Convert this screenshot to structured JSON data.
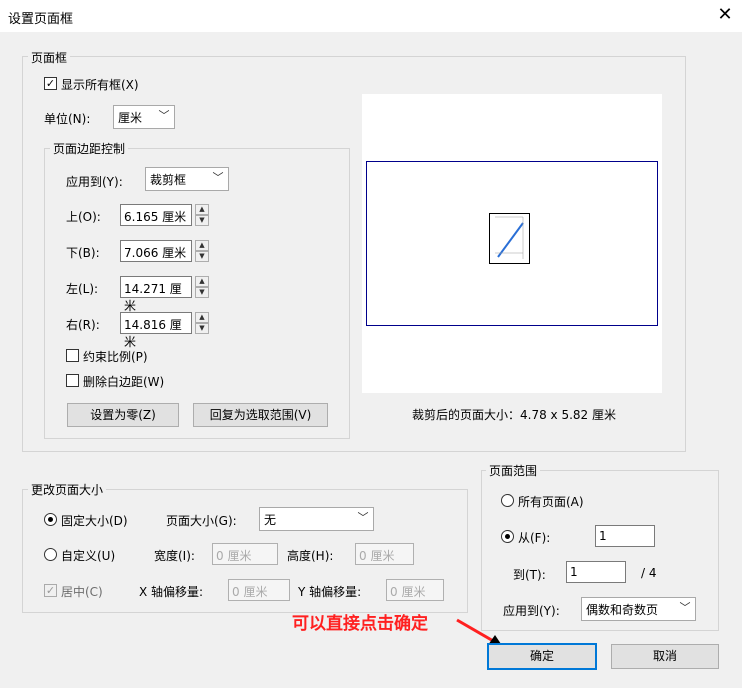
{
  "window": {
    "title": "设置页面框",
    "close_glyph": "✕"
  },
  "page_box": {
    "legend": "页面框",
    "show_all_boxes": {
      "label": "显示所有框(X)",
      "checked": true
    },
    "unit": {
      "label": "单位(N):",
      "value": "厘米"
    }
  },
  "margin_control": {
    "legend": "页面边距控制",
    "apply_to": {
      "label": "应用到(Y):",
      "value": "裁剪框"
    },
    "top": {
      "label": "上(O):",
      "value": "6.165 厘米"
    },
    "bottom": {
      "label": "下(B):",
      "value": "7.066 厘米"
    },
    "left": {
      "label": "左(L):",
      "value": "14.271 厘米"
    },
    "right": {
      "label": "右(R):",
      "value": "14.816 厘米"
    },
    "constrain": {
      "label": "约束比例(P)",
      "checked": false
    },
    "remove_white": {
      "label": "删除白边距(W)",
      "checked": false
    },
    "set_zero": "设置为零(Z)",
    "revert": "回复为选取范围(V)"
  },
  "preview": {
    "caption": "裁剪后的页面大小：4.78 x 5.82 厘米",
    "box_color": "#00008b"
  },
  "change_size": {
    "legend": "更改页面大小",
    "fixed_size": {
      "label": "固定大小(D)",
      "selected": true
    },
    "page_size": {
      "label": "页面大小(G):",
      "value": "无"
    },
    "custom": {
      "label": "自定义(U)",
      "selected": false
    },
    "width": {
      "label": "宽度(I):",
      "value": "0 厘米"
    },
    "height": {
      "label": "高度(H):",
      "value": "0 厘米"
    },
    "center": {
      "label": "居中(C)",
      "checked": true,
      "disabled": true
    },
    "x_offset": {
      "label": "X 轴偏移量:",
      "value": "0 厘米"
    },
    "y_offset": {
      "label": "Y 轴偏移量:",
      "value": "0 厘米"
    }
  },
  "page_range": {
    "legend": "页面范围",
    "all_pages": {
      "label": "所有页面(A)",
      "selected": false
    },
    "from": {
      "label": "从(F):",
      "value": "1",
      "selected": true
    },
    "to": {
      "label": "到(T):",
      "value": "1",
      "total": "/ 4"
    },
    "apply_to": {
      "label": "应用到(Y):",
      "value": "偶数和奇数页"
    }
  },
  "annotation": {
    "text": "可以直接点击确定",
    "color": "#ff2020"
  },
  "buttons": {
    "ok": "确定",
    "cancel": "取消"
  }
}
